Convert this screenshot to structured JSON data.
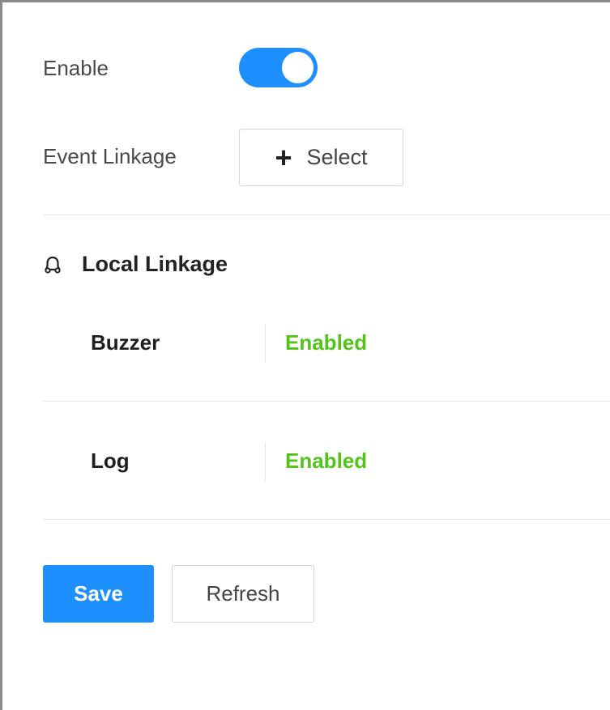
{
  "form": {
    "enable_label": "Enable",
    "enable_state": "on",
    "event_linkage_label": "Event Linkage",
    "select_button_label": "Select",
    "select_button_icon": "plus-icon"
  },
  "local_linkage": {
    "title": "Local Linkage",
    "icon": "bell-icon",
    "items": [
      {
        "label": "Buzzer",
        "value": "Enabled"
      },
      {
        "label": "Log",
        "value": "Enabled"
      }
    ]
  },
  "actions": {
    "save_label": "Save",
    "refresh_label": "Refresh"
  },
  "colors": {
    "accent": "#1e8fff",
    "enabled_status": "#52c41a"
  }
}
